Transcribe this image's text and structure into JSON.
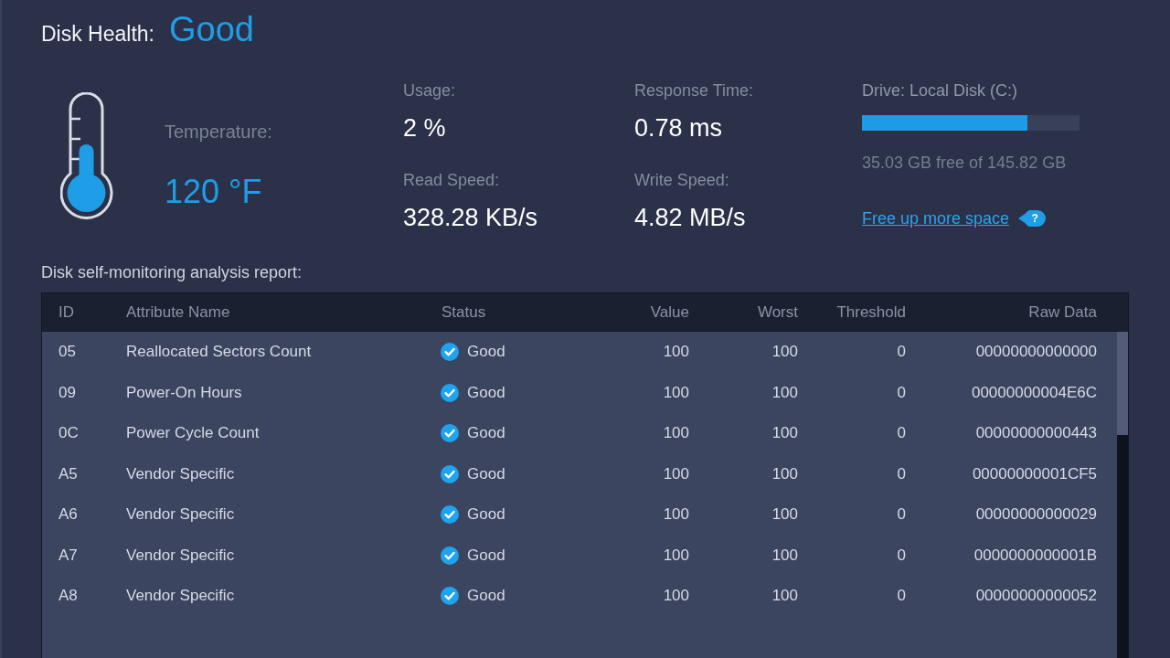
{
  "disk_health": {
    "label": "Disk Health:",
    "value": "Good"
  },
  "temperature": {
    "label": "Temperature:",
    "value": "120 °F"
  },
  "stat_columns": [
    {
      "items": [
        {
          "label": "Usage:",
          "value": "2 %"
        },
        {
          "label": "Read Speed:",
          "value": "328.28 KB/s"
        }
      ]
    },
    {
      "items": [
        {
          "label": "Response Time:",
          "value": "0.78 ms"
        },
        {
          "label": "Write Speed:",
          "value": "4.82 MB/s"
        }
      ]
    }
  ],
  "drive": {
    "label": "Drive: Local Disk (C:)",
    "level": 0.76,
    "free_space": "35.03 GB free of 145.82 GB",
    "link": "Free up more space",
    "help_glyph": "?"
  },
  "report": {
    "title": "Disk self-monitoring analysis report:",
    "columns": [
      "ID",
      "Attribute Name",
      "Status",
      "Value",
      "Worst",
      "Threshold",
      "Raw Data"
    ],
    "rows": [
      {
        "id": "05",
        "attribute": "Reallocated Sectors Count",
        "status": {
          "label": "Good",
          "kind": "ok"
        },
        "value": "100",
        "worst": "100",
        "threshold": "0",
        "raw_data": "00000000000000"
      },
      {
        "id": "09",
        "attribute": "Power-On Hours",
        "status": {
          "label": "Good",
          "kind": "ok"
        },
        "value": "100",
        "worst": "100",
        "threshold": "0",
        "raw_data": "00000000004E6C"
      },
      {
        "id": "0C",
        "attribute": "Power Cycle Count",
        "status": {
          "label": "Good",
          "kind": "ok"
        },
        "value": "100",
        "worst": "100",
        "threshold": "0",
        "raw_data": "00000000000443"
      },
      {
        "id": "A5",
        "attribute": "Vendor Specific",
        "status": {
          "label": "Good",
          "kind": "ok"
        },
        "value": "100",
        "worst": "100",
        "threshold": "0",
        "raw_data": "00000000001CF5"
      },
      {
        "id": "A6",
        "attribute": "Vendor Specific",
        "status": {
          "label": "Good",
          "kind": "ok"
        },
        "value": "100",
        "worst": "100",
        "threshold": "0",
        "raw_data": "00000000000029"
      },
      {
        "id": "A7",
        "attribute": "Vendor Specific",
        "status": {
          "label": "Good",
          "kind": "ok"
        },
        "value": "100",
        "worst": "100",
        "threshold": "0",
        "raw_data": "0000000000001B"
      },
      {
        "id": "A8",
        "attribute": "Vendor Specific",
        "status": {
          "label": "Good",
          "kind": "ok"
        },
        "value": "100",
        "worst": "100",
        "threshold": "0",
        "raw_data": "00000000000052"
      }
    ]
  }
}
